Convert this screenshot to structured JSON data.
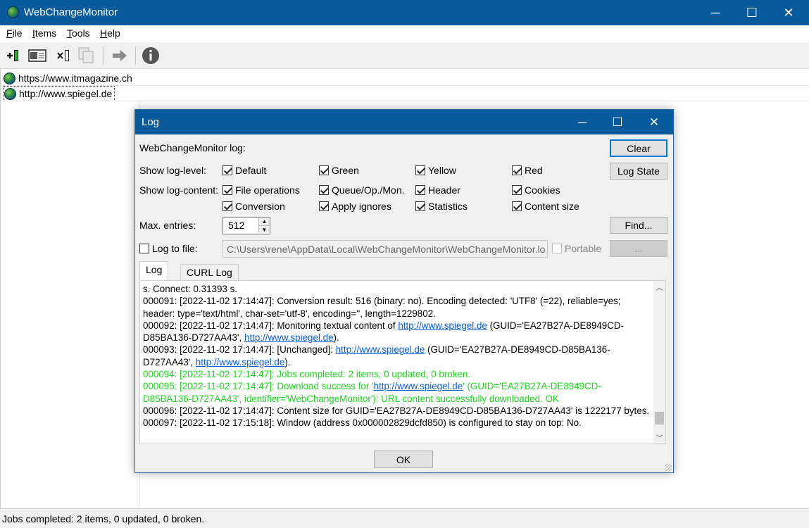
{
  "app": {
    "title": "WebChangeMonitor",
    "window_controls": {
      "minimize": "─",
      "maximize": "☐",
      "close": "✕"
    }
  },
  "menu": [
    {
      "label": "File",
      "mnemonic": "F",
      "rest": "ile"
    },
    {
      "label": "Items",
      "mnemonic": "I",
      "rest": "tems"
    },
    {
      "label": "Tools",
      "mnemonic": "T",
      "rest": "ools"
    },
    {
      "label": "Help",
      "mnemonic": "H",
      "rest": "elp"
    }
  ],
  "toolbar": {
    "icons": [
      "add-item-icon",
      "edit-item-icon",
      "delete-item-icon",
      "copy-item-icon",
      "check-now-icon",
      "info-icon"
    ]
  },
  "items": [
    {
      "url": "https://www.itmagazine.ch",
      "icon": "globe-icon"
    },
    {
      "url": "http://www.spiegel.de",
      "icon": "globe-icon"
    }
  ],
  "status": "Jobs completed: 2 items, 0 updated, 0 broken.",
  "dialog": {
    "title": "Log",
    "heading": "WebChangeMonitor log:",
    "clear_label": "Clear",
    "logstate_label": "Log State",
    "find_label": "Find...",
    "browse_label": "...",
    "ok_label": "OK",
    "show_level_label": "Show log-level:",
    "show_content_label": "Show log-content:",
    "max_entries_label": "Max. entries:",
    "max_entries_value": "512",
    "log_to_file_label": "Log to file:",
    "log_to_file_checked": false,
    "log_file_path": "C:\\Users\\rene\\AppData\\Local\\WebChangeMonitor\\WebChangeMonitor.lo",
    "portable_label": "Portable",
    "levels": [
      {
        "label": "Default",
        "checked": true
      },
      {
        "label": "Green",
        "checked": true
      },
      {
        "label": "Yellow",
        "checked": true
      },
      {
        "label": "Red",
        "checked": true
      }
    ],
    "contents_row1": [
      {
        "label": "File operations",
        "checked": true
      },
      {
        "label": "Queue/Op./Mon.",
        "checked": true
      },
      {
        "label": "Header",
        "checked": true
      },
      {
        "label": "Cookies",
        "checked": true
      }
    ],
    "contents_row2": [
      {
        "label": "Conversion",
        "checked": true
      },
      {
        "label": "Apply ignores",
        "checked": true
      },
      {
        "label": "Statistics",
        "checked": true
      },
      {
        "label": "Content size",
        "checked": true
      }
    ],
    "tabs": [
      "Log",
      "CURL Log"
    ],
    "log_lines": {
      "l0": "s. Connect: 0.31393 s.",
      "l1": "000091: [2022-11-02 17:14:47]: Conversion result: 516 (binary: no). Encoding detected: 'UTF8' (=22), reliable=yes; header: type='text/html', char-set='utf-8', encoding='', length=1229802.",
      "l2a": "000092: [2022-11-02 17:14:47]: Monitoring textual content of ",
      "l2link1": "http://www.spiegel.de",
      "l2b": " (GUID='EA27B27A-DE8949CD-D85BA136-D727AA43', ",
      "l2link2": "http://www.spiegel.de",
      "l2c": ").",
      "l3a": "000093: [2022-11-02 17:14:47]: [Unchanged]: ",
      "l3link1": "http://www.spiegel.de",
      "l3b": " (GUID='EA27B27A-DE8949CD-D85BA136-D727AA43', ",
      "l3link2": "http://www.spiegel.de",
      "l3c": ").",
      "l4": "000094: [2022-11-02 17:14:47]: Jobs completed: 2 items, 0 updated, 0 broken.",
      "l5a": "000095: [2022-11-02 17:14:47]: Download success for '",
      "l5link": "http://www.spiegel.de",
      "l5b": "' (GUID='EA27B27A-DE8949CD-D85BA136-D727AA43', identifier='WebChangeMonitor'): URL content successfully downloaded. OK",
      "l6": "000096: [2022-11-02 17:14:47]: Content size for GUID='EA27B27A-DE8949CD-D85BA136-D727AA43' is 1222177 bytes.",
      "l7": "000097: [2022-11-02 17:15:18]: Window (address 0x000002829dcfd850) is configured to stay on top: No."
    },
    "colors": {
      "accent": "#075a9c",
      "green_log": "#1ed81e",
      "link": "#0b5ed7"
    }
  }
}
